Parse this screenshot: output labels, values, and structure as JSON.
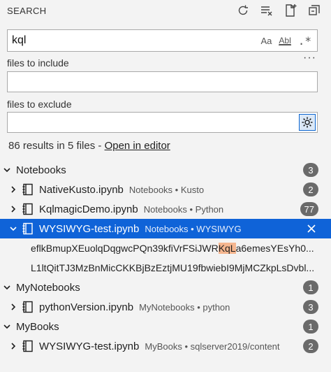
{
  "header": {
    "title": "SEARCH"
  },
  "search": {
    "value": "kql",
    "case_label": "Aa",
    "word_label": "Abl",
    "regex_label": ".*"
  },
  "include": {
    "label": "files to include",
    "value": ""
  },
  "exclude": {
    "label": "files to exclude",
    "value": ""
  },
  "summary": {
    "text": "86 results in 5 files - ",
    "link": "Open in editor"
  },
  "tree": {
    "g1": {
      "name": "Notebooks",
      "count": "3",
      "f1": {
        "name": "NativeKusto.ipynb",
        "path": "Notebooks • Kusto",
        "count": "2"
      },
      "f2": {
        "name": "KqlmagicDemo.ipynb",
        "path": "Notebooks • Python",
        "count": "77"
      },
      "f3": {
        "name": "WYSIWYG-test.ipynb",
        "path": "Notebooks • WYSIWYG"
      },
      "m1": {
        "pre": "eflkBmupXEuolqDqgwcPQn39kfiVrFSiJWR",
        "hit": "KqL",
        "post": "a6emesYEsYh0..."
      },
      "m2": {
        "text": "L1ltQitTJ3MzBnMicCKKBjBzEztjMU19fbwiebI9MjMCZkpLsDvbl..."
      }
    },
    "g2": {
      "name": "MyNotebooks",
      "count": "1",
      "f1": {
        "name": "pythonVersion.ipynb",
        "path": "MyNotebooks • python",
        "count": "3"
      }
    },
    "g3": {
      "name": "MyBooks",
      "count": "1",
      "f1": {
        "name": "WYSIWYG-test.ipynb",
        "path": "MyBooks • sqlserver2019/content",
        "count": "2"
      }
    }
  }
}
